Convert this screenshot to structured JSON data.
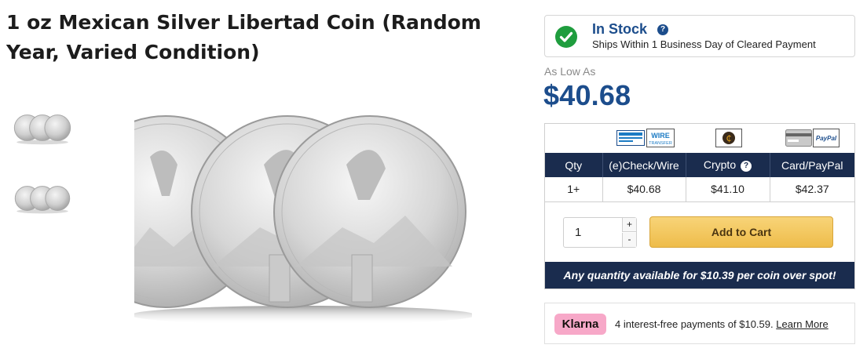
{
  "product": {
    "title": "1 oz Mexican Silver Libertad Coin (Random Year, Varied Condition)"
  },
  "stock": {
    "status": "In Stock",
    "help": "?",
    "shipping": "Ships Within 1 Business Day of Cleared Payment"
  },
  "pricing": {
    "as_low_as": "As Low As",
    "price": "$40.68"
  },
  "payment_icons": {
    "wire": "WIRE",
    "wire_sub": "TRANSFER",
    "paypal": "PayPal",
    "crypto_symbol": "₵"
  },
  "price_table": {
    "headers": [
      "Qty",
      "(e)Check/Wire",
      "Crypto",
      "Card/PayPal"
    ],
    "crypto_help": "?",
    "rows": [
      [
        "1+",
        "$40.68",
        "$41.10",
        "$42.37"
      ]
    ]
  },
  "cart": {
    "quantity": "1",
    "plus": "+",
    "minus": "-",
    "add_to_cart": "Add to Cart"
  },
  "spot_banner": "Any quantity available for $10.39 per coin over spot!",
  "klarna": {
    "badge": "Klarna",
    "text": "4 interest-free payments of $10.59.",
    "learn_more": "Learn More"
  },
  "colors": {
    "brand_blue": "#1c4d8c",
    "table_header": "#1a2c4e",
    "in_stock_green": "#1f9d3e",
    "cart_gold": "#eebc4a",
    "klarna_pink": "#f7a8c8"
  }
}
